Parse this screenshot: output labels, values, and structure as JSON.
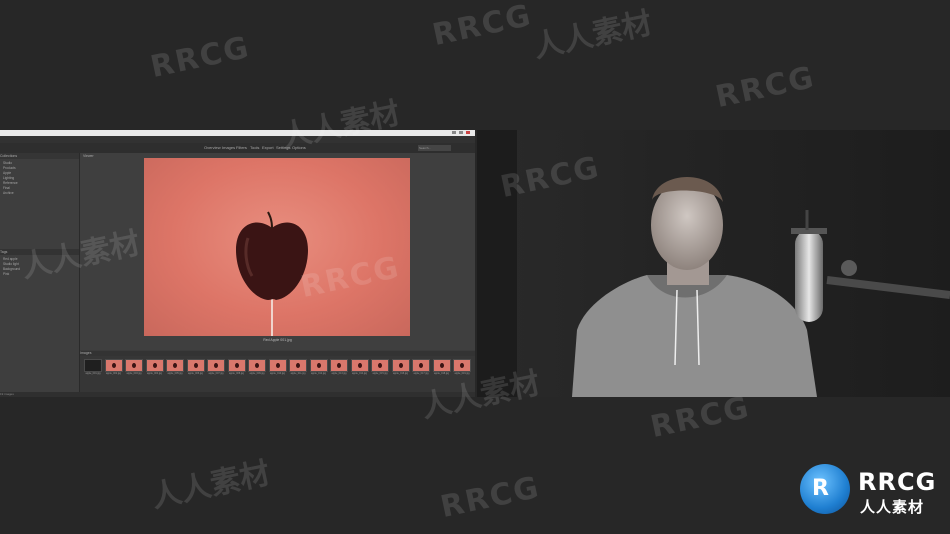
{
  "watermark": {
    "en": "RRCG",
    "cn": "人人素材"
  },
  "logo": {
    "en": "RRCG",
    "cn": "人人素材"
  },
  "app": {
    "toolbar_title_items": [
      "Overview",
      "Images",
      "Filters",
      "Tools",
      "Export",
      "Settings",
      "Options"
    ],
    "search_placeholder": "Search...",
    "left_panel": {
      "header": "Collections",
      "items": [
        "Studio",
        "Products",
        "Apple",
        "Lighting",
        "Reference",
        "Final",
        "Archive"
      ],
      "section2_header": "Tags",
      "section2_items": [
        "Red apple",
        "Studio light",
        "Background",
        "Pink"
      ]
    },
    "viewer_label": "Viewer",
    "photo_caption": "Red Apple 001.jpg",
    "filmstrip_label": "Images",
    "thumbnails": [
      "apple_001.jpg",
      "apple_002.jpg",
      "apple_003.jpg",
      "apple_004.jpg",
      "apple_005.jpg",
      "apple_006.jpg",
      "apple_007.jpg",
      "apple_008.jpg",
      "apple_009.jpg",
      "apple_010.jpg",
      "apple_011.jpg",
      "apple_012.jpg",
      "apple_013.jpg",
      "apple_014.jpg",
      "apple_015.jpg",
      "apple_016.jpg",
      "apple_017.jpg",
      "apple_018.jpg",
      "apple_019.jpg"
    ],
    "status": "19 images"
  },
  "colors": {
    "background": "#272727",
    "photo_backdrop": "#dd7567",
    "apple": "#3a1414",
    "logo_blue": "#1f7fd1"
  }
}
